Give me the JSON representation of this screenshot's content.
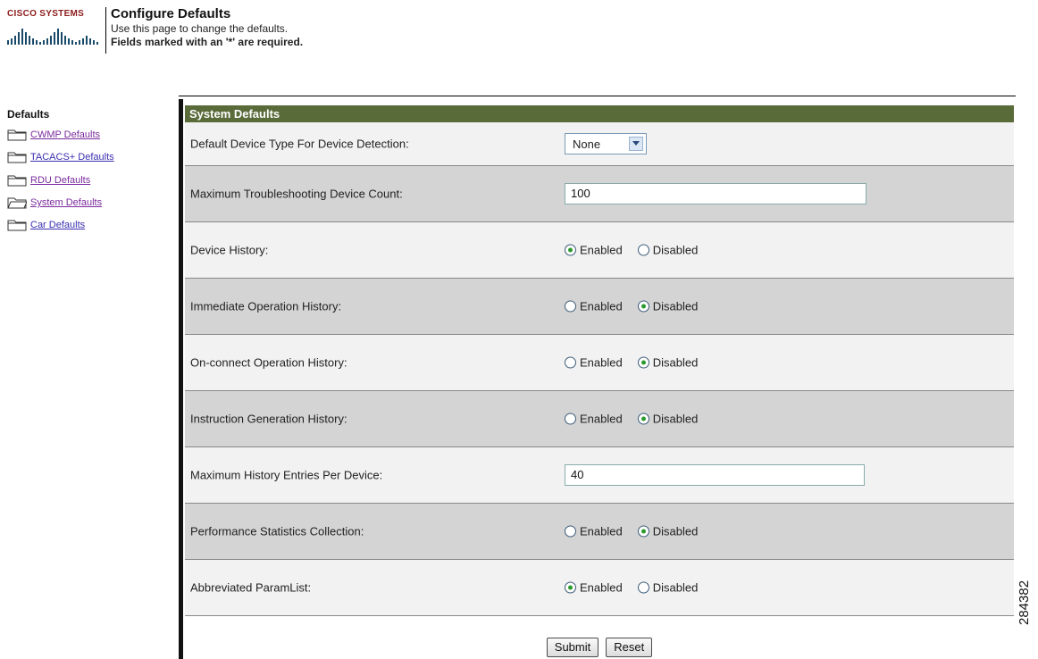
{
  "header": {
    "brand": "Cisco Systems",
    "title": "Configure Defaults",
    "subtitle": "Use this page to change the defaults.",
    "required_note": "Fields marked with an '*' are required."
  },
  "sidebar": {
    "heading": "Defaults",
    "items": [
      {
        "label": "CWMP Defaults",
        "visited": true
      },
      {
        "label": "TACACS+ Defaults",
        "visited": false
      },
      {
        "label": "RDU Defaults",
        "visited": true
      },
      {
        "label": "System Defaults",
        "visited": true,
        "active": true
      },
      {
        "label": "Car Defaults",
        "visited": false
      }
    ]
  },
  "panel": {
    "heading": "System Defaults",
    "device_type": {
      "label": "Default Device Type For Device Detection:",
      "value": "None"
    },
    "max_troubleshooting": {
      "label": "Maximum Troubleshooting Device Count:",
      "value": "100"
    },
    "device_history": {
      "label": "Device History:",
      "selected": "Enabled"
    },
    "immediate_op_history": {
      "label": "Immediate Operation History:",
      "selected": "Disabled"
    },
    "onconnect_op_history": {
      "label": "On-connect Operation History:",
      "selected": "Disabled"
    },
    "instruction_gen_history": {
      "label": "Instruction Generation History:",
      "selected": "Disabled"
    },
    "max_history_entries": {
      "label": "Maximum History Entries Per Device:",
      "value": "40"
    },
    "perf_stats": {
      "label": "Performance Statistics Collection:",
      "selected": "Disabled"
    },
    "abbreviated_paramlist": {
      "label": "Abbreviated ParamList:",
      "selected": "Enabled"
    },
    "radio_labels": {
      "enabled": "Enabled",
      "disabled": "Disabled"
    }
  },
  "buttons": {
    "submit": "Submit",
    "reset": "Reset"
  },
  "figure_id": "284382",
  "colors": {
    "panel_header": "#5a6b3a",
    "row_light": "#f2f2f2",
    "row_dark": "#d4d4d4",
    "link": "#3a2fb0",
    "link_visited": "#7a2a9c",
    "brand": "#8b1a1a"
  }
}
